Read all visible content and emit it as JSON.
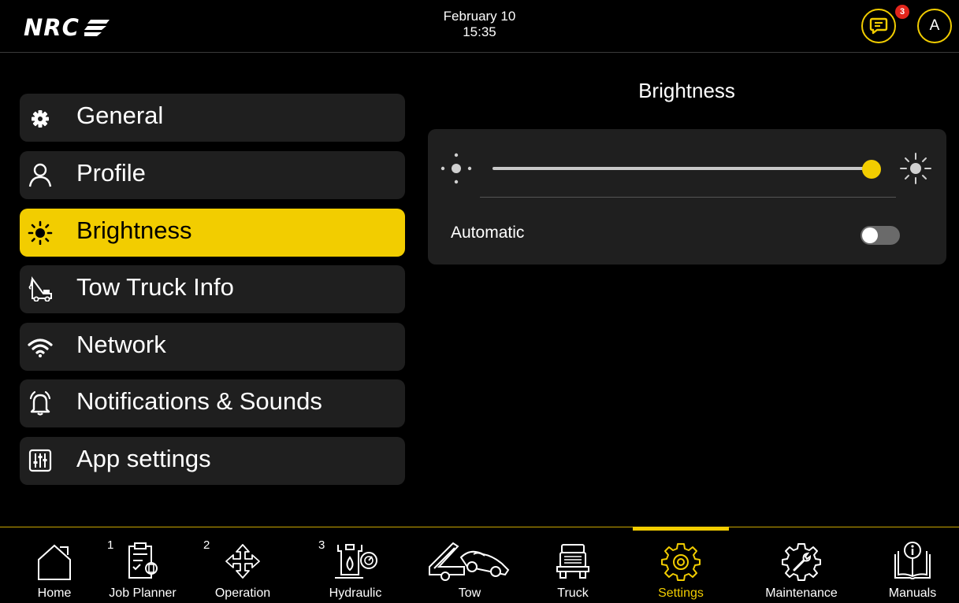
{
  "header": {
    "logo_text": "NRC",
    "date": "February 10",
    "time": "15:35",
    "messages_badge": "3",
    "avatar_initial": "A",
    "accent_color": "#f2cd00"
  },
  "sidebar": {
    "items": [
      {
        "label": "General",
        "icon": "gear-icon"
      },
      {
        "label": "Profile",
        "icon": "user-icon"
      },
      {
        "label": "Brightness",
        "icon": "sun-icon",
        "active": true
      },
      {
        "label": "Tow Truck Info",
        "icon": "tow-truck-icon"
      },
      {
        "label": "Network",
        "icon": "wifi-icon"
      },
      {
        "label": "Notifications & Sounds",
        "icon": "bell-icon"
      },
      {
        "label": "App settings",
        "icon": "sliders-icon"
      }
    ]
  },
  "main": {
    "title": "Brightness",
    "brightness_level": 1.0,
    "automatic_label": "Automatic",
    "automatic_enabled": false
  },
  "bottom_nav": {
    "items": [
      {
        "label": "Home",
        "icon": "home-icon"
      },
      {
        "label": "Job Planner",
        "icon": "job-planner-icon",
        "number": "1"
      },
      {
        "label": "Operation",
        "icon": "move-arrows-icon",
        "number": "2"
      },
      {
        "label": "Hydraulic",
        "icon": "hydraulic-icon",
        "number": "3"
      },
      {
        "label": "Tow",
        "icon": "tow-icon"
      },
      {
        "label": "Truck",
        "icon": "truck-icon"
      },
      {
        "label": "Settings",
        "icon": "settings-gear-icon",
        "active": true
      },
      {
        "label": "Maintenance",
        "icon": "maintenance-icon"
      },
      {
        "label": "Manuals",
        "icon": "manual-book-icon"
      }
    ]
  }
}
